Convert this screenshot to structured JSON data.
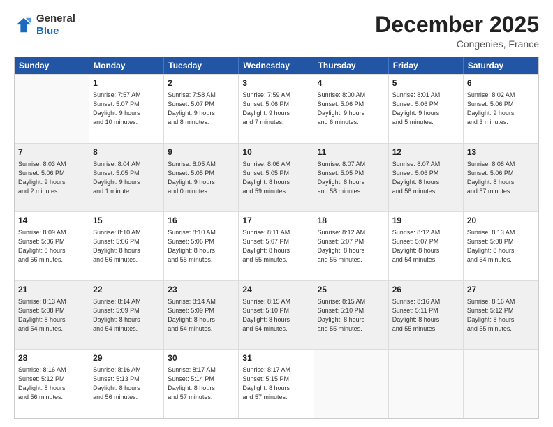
{
  "header": {
    "logo_general": "General",
    "logo_blue": "Blue",
    "title": "December 2025",
    "location": "Congenies, France"
  },
  "days_of_week": [
    "Sunday",
    "Monday",
    "Tuesday",
    "Wednesday",
    "Thursday",
    "Friday",
    "Saturday"
  ],
  "rows": [
    [
      {
        "num": "",
        "lines": [],
        "empty": true
      },
      {
        "num": "1",
        "lines": [
          "Sunrise: 7:57 AM",
          "Sunset: 5:07 PM",
          "Daylight: 9 hours",
          "and 10 minutes."
        ]
      },
      {
        "num": "2",
        "lines": [
          "Sunrise: 7:58 AM",
          "Sunset: 5:07 PM",
          "Daylight: 9 hours",
          "and 8 minutes."
        ]
      },
      {
        "num": "3",
        "lines": [
          "Sunrise: 7:59 AM",
          "Sunset: 5:06 PM",
          "Daylight: 9 hours",
          "and 7 minutes."
        ]
      },
      {
        "num": "4",
        "lines": [
          "Sunrise: 8:00 AM",
          "Sunset: 5:06 PM",
          "Daylight: 9 hours",
          "and 6 minutes."
        ]
      },
      {
        "num": "5",
        "lines": [
          "Sunrise: 8:01 AM",
          "Sunset: 5:06 PM",
          "Daylight: 9 hours",
          "and 5 minutes."
        ]
      },
      {
        "num": "6",
        "lines": [
          "Sunrise: 8:02 AM",
          "Sunset: 5:06 PM",
          "Daylight: 9 hours",
          "and 3 minutes."
        ]
      }
    ],
    [
      {
        "num": "7",
        "lines": [
          "Sunrise: 8:03 AM",
          "Sunset: 5:06 PM",
          "Daylight: 9 hours",
          "and 2 minutes."
        ],
        "shaded": true
      },
      {
        "num": "8",
        "lines": [
          "Sunrise: 8:04 AM",
          "Sunset: 5:05 PM",
          "Daylight: 9 hours",
          "and 1 minute."
        ],
        "shaded": true
      },
      {
        "num": "9",
        "lines": [
          "Sunrise: 8:05 AM",
          "Sunset: 5:05 PM",
          "Daylight: 9 hours",
          "and 0 minutes."
        ],
        "shaded": true
      },
      {
        "num": "10",
        "lines": [
          "Sunrise: 8:06 AM",
          "Sunset: 5:05 PM",
          "Daylight: 8 hours",
          "and 59 minutes."
        ],
        "shaded": true
      },
      {
        "num": "11",
        "lines": [
          "Sunrise: 8:07 AM",
          "Sunset: 5:05 PM",
          "Daylight: 8 hours",
          "and 58 minutes."
        ],
        "shaded": true
      },
      {
        "num": "12",
        "lines": [
          "Sunrise: 8:07 AM",
          "Sunset: 5:06 PM",
          "Daylight: 8 hours",
          "and 58 minutes."
        ],
        "shaded": true
      },
      {
        "num": "13",
        "lines": [
          "Sunrise: 8:08 AM",
          "Sunset: 5:06 PM",
          "Daylight: 8 hours",
          "and 57 minutes."
        ],
        "shaded": true
      }
    ],
    [
      {
        "num": "14",
        "lines": [
          "Sunrise: 8:09 AM",
          "Sunset: 5:06 PM",
          "Daylight: 8 hours",
          "and 56 minutes."
        ]
      },
      {
        "num": "15",
        "lines": [
          "Sunrise: 8:10 AM",
          "Sunset: 5:06 PM",
          "Daylight: 8 hours",
          "and 56 minutes."
        ]
      },
      {
        "num": "16",
        "lines": [
          "Sunrise: 8:10 AM",
          "Sunset: 5:06 PM",
          "Daylight: 8 hours",
          "and 55 minutes."
        ]
      },
      {
        "num": "17",
        "lines": [
          "Sunrise: 8:11 AM",
          "Sunset: 5:07 PM",
          "Daylight: 8 hours",
          "and 55 minutes."
        ]
      },
      {
        "num": "18",
        "lines": [
          "Sunrise: 8:12 AM",
          "Sunset: 5:07 PM",
          "Daylight: 8 hours",
          "and 55 minutes."
        ]
      },
      {
        "num": "19",
        "lines": [
          "Sunrise: 8:12 AM",
          "Sunset: 5:07 PM",
          "Daylight: 8 hours",
          "and 54 minutes."
        ]
      },
      {
        "num": "20",
        "lines": [
          "Sunrise: 8:13 AM",
          "Sunset: 5:08 PM",
          "Daylight: 8 hours",
          "and 54 minutes."
        ]
      }
    ],
    [
      {
        "num": "21",
        "lines": [
          "Sunrise: 8:13 AM",
          "Sunset: 5:08 PM",
          "Daylight: 8 hours",
          "and 54 minutes."
        ],
        "shaded": true
      },
      {
        "num": "22",
        "lines": [
          "Sunrise: 8:14 AM",
          "Sunset: 5:09 PM",
          "Daylight: 8 hours",
          "and 54 minutes."
        ],
        "shaded": true
      },
      {
        "num": "23",
        "lines": [
          "Sunrise: 8:14 AM",
          "Sunset: 5:09 PM",
          "Daylight: 8 hours",
          "and 54 minutes."
        ],
        "shaded": true
      },
      {
        "num": "24",
        "lines": [
          "Sunrise: 8:15 AM",
          "Sunset: 5:10 PM",
          "Daylight: 8 hours",
          "and 54 minutes."
        ],
        "shaded": true
      },
      {
        "num": "25",
        "lines": [
          "Sunrise: 8:15 AM",
          "Sunset: 5:10 PM",
          "Daylight: 8 hours",
          "and 55 minutes."
        ],
        "shaded": true
      },
      {
        "num": "26",
        "lines": [
          "Sunrise: 8:16 AM",
          "Sunset: 5:11 PM",
          "Daylight: 8 hours",
          "and 55 minutes."
        ],
        "shaded": true
      },
      {
        "num": "27",
        "lines": [
          "Sunrise: 8:16 AM",
          "Sunset: 5:12 PM",
          "Daylight: 8 hours",
          "and 55 minutes."
        ],
        "shaded": true
      }
    ],
    [
      {
        "num": "28",
        "lines": [
          "Sunrise: 8:16 AM",
          "Sunset: 5:12 PM",
          "Daylight: 8 hours",
          "and 56 minutes."
        ]
      },
      {
        "num": "29",
        "lines": [
          "Sunrise: 8:16 AM",
          "Sunset: 5:13 PM",
          "Daylight: 8 hours",
          "and 56 minutes."
        ]
      },
      {
        "num": "30",
        "lines": [
          "Sunrise: 8:17 AM",
          "Sunset: 5:14 PM",
          "Daylight: 8 hours",
          "and 57 minutes."
        ]
      },
      {
        "num": "31",
        "lines": [
          "Sunrise: 8:17 AM",
          "Sunset: 5:15 PM",
          "Daylight: 8 hours",
          "and 57 minutes."
        ]
      },
      {
        "num": "",
        "lines": [],
        "empty": true
      },
      {
        "num": "",
        "lines": [],
        "empty": true
      },
      {
        "num": "",
        "lines": [],
        "empty": true
      }
    ]
  ]
}
